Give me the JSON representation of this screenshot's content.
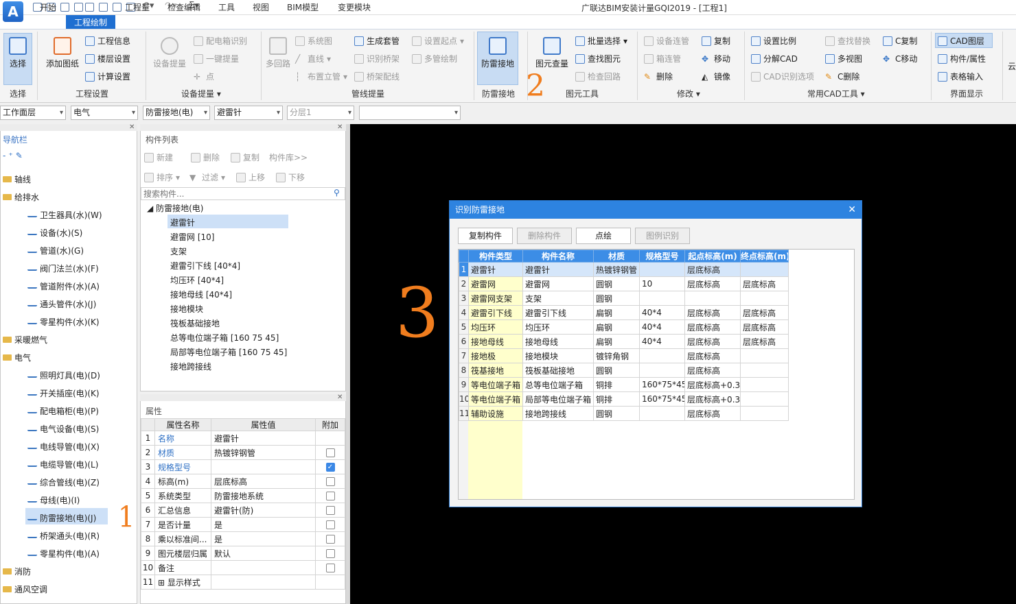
{
  "app": {
    "title": "广联达BIM安装计量GQI2019 - [工程1]",
    "logo": "A"
  },
  "menu": [
    "开始",
    "工程绘制",
    "工程量",
    "检查编辑",
    "工具",
    "视图",
    "BIM模型",
    "变更模块"
  ],
  "menu_active": "工程绘制",
  "ribbon": {
    "select": {
      "label": "选择",
      "group": "选择"
    },
    "project": {
      "add_drawing": "添加图纸",
      "info": "工程信息",
      "floors": "楼层设置",
      "calc": "计算设置",
      "group": "工程设置"
    },
    "equipment": {
      "big": "设备提量",
      "box_identify": "配电箱识别",
      "one_key": "一键提量",
      "point": "点",
      "group": "设备提量"
    },
    "pipeline": {
      "multi_loop": "多回路",
      "system_map": "系统图",
      "line": "直线",
      "riser": "布置立管",
      "gen_fitting": "生成套管",
      "identify_tray": "识别桥架",
      "tray_wire": "桥架配线",
      "set_start": "设置起点",
      "multi_draw": "多管绘制",
      "group": "管线提量"
    },
    "lightning": {
      "label": "防雷接地",
      "group": "防雷接地"
    },
    "elem_tools": {
      "query": "图元查量",
      "batch_select": "批量选择",
      "find": "查找图元",
      "check_loop": "检查回路",
      "group": "图元工具"
    },
    "modify": {
      "equip_link": "设备连管",
      "box_pipe": "箱连管",
      "delete": "删除",
      "copy": "复制",
      "move": "移动",
      "mirror": "镜像",
      "group": "修改"
    },
    "cad_tools": {
      "set_scale": "设置比例",
      "explode": "分解CAD",
      "cad_options": "CAD识别选项",
      "find_replace": "查找替换",
      "multi_view": "多视图",
      "c_delete": "C删除",
      "c_copy": "C复制",
      "c_move": "C移动",
      "group": "常用CAD工具"
    },
    "display": {
      "cad_layer": "CAD图层",
      "comp_attr": "构件/属性",
      "table_input": "表格输入",
      "group": "界面显示"
    },
    "cloud": "云"
  },
  "filters": [
    "工作面层",
    "电气",
    "防雷接地(电)",
    "避雷针",
    "分层1",
    ""
  ],
  "nav": {
    "title": "导航栏",
    "items": [
      {
        "label": "轴线",
        "level": 0
      },
      {
        "label": "给排水",
        "level": 0
      },
      {
        "label": "卫生器具(水)(W)",
        "level": 1
      },
      {
        "label": "设备(水)(S)",
        "level": 1
      },
      {
        "label": "管道(水)(G)",
        "level": 1
      },
      {
        "label": "阀门法兰(水)(F)",
        "level": 1
      },
      {
        "label": "管道附件(水)(A)",
        "level": 1
      },
      {
        "label": "通头管件(水)(J)",
        "level": 1
      },
      {
        "label": "零星构件(水)(K)",
        "level": 1
      },
      {
        "label": "采暖燃气",
        "level": 0
      },
      {
        "label": "电气",
        "level": 0
      },
      {
        "label": "照明灯具(电)(D)",
        "level": 1
      },
      {
        "label": "开关插座(电)(K)",
        "level": 1
      },
      {
        "label": "配电箱柜(电)(P)",
        "level": 1
      },
      {
        "label": "电气设备(电)(S)",
        "level": 1
      },
      {
        "label": "电线导管(电)(X)",
        "level": 1
      },
      {
        "label": "电缆导管(电)(L)",
        "level": 1
      },
      {
        "label": "综合管线(电)(Z)",
        "level": 1
      },
      {
        "label": "母线(电)(I)",
        "level": 1
      },
      {
        "label": "防雷接地(电)(J)",
        "level": 1
      },
      {
        "label": "桥架通头(电)(R)",
        "level": 1
      },
      {
        "label": "零星构件(电)(A)",
        "level": 1
      },
      {
        "label": "消防",
        "level": 0
      },
      {
        "label": "通风空调",
        "level": 0
      }
    ]
  },
  "complist": {
    "title": "构件列表",
    "tools": {
      "new": "新建",
      "delete": "删除",
      "copy": "复制",
      "library": "构件库>>",
      "sort": "排序",
      "filter": "过滤",
      "up": "上移",
      "down": "下移"
    },
    "search_placeholder": "搜索构件...",
    "root": "防雷接地(电)",
    "items": [
      "避雷针",
      "避雷网 [10]",
      "支架",
      "避雷引下线 [40*4]",
      "均压环 [40*4]",
      "接地母线 [40*4]",
      "接地模块",
      "筏板基础接地",
      "总等电位端子箱 [160 75 45]",
      "局部等电位端子箱 [160 75 45]",
      "接地跨接线"
    ]
  },
  "props": {
    "title": "属性",
    "headers": [
      "属性名称",
      "属性值",
      "附加"
    ],
    "rows": [
      {
        "n": "1",
        "name": "名称",
        "value": "避雷针",
        "cb": "none",
        "blue": true
      },
      {
        "n": "2",
        "name": "材质",
        "value": "热镀锌钢管",
        "cb": "off",
        "blue": true
      },
      {
        "n": "3",
        "name": "规格型号",
        "value": "",
        "cb": "on",
        "blue": true
      },
      {
        "n": "4",
        "name": "标高(m)",
        "value": "层底标高",
        "cb": "off",
        "blue": false
      },
      {
        "n": "5",
        "name": "系统类型",
        "value": "防雷接地系统",
        "cb": "off",
        "blue": false
      },
      {
        "n": "6",
        "name": "汇总信息",
        "value": "避雷针(防)",
        "cb": "off",
        "blue": false
      },
      {
        "n": "7",
        "name": "是否计量",
        "value": "是",
        "cb": "off",
        "blue": false
      },
      {
        "n": "8",
        "name": "乘以标准间...",
        "value": "是",
        "cb": "off",
        "blue": false
      },
      {
        "n": "9",
        "name": "图元楼层归属",
        "value": "默认",
        "cb": "off",
        "blue": false
      },
      {
        "n": "10",
        "name": "备注",
        "value": "",
        "cb": "off",
        "blue": false
      },
      {
        "n": "11",
        "name": "显示样式",
        "value": "",
        "cb": "none",
        "blue": false
      }
    ]
  },
  "dialog": {
    "title": "识别防雷接地",
    "buttons": [
      "复制构件",
      "删除构件",
      "点绘",
      "图例识别"
    ],
    "headers": [
      "构件类型",
      "构件名称",
      "材质",
      "规格型号",
      "起点标高(m)",
      "终点标高(m)"
    ],
    "rows": [
      [
        "1",
        "避雷针",
        "避雷针",
        "热镀锌钢管",
        "",
        "层底标高",
        ""
      ],
      [
        "2",
        "避雷网",
        "避雷网",
        "圆钢",
        "10",
        "层底标高",
        "层底标高"
      ],
      [
        "3",
        "避雷网支架",
        "支架",
        "圆钢",
        "",
        "",
        ""
      ],
      [
        "4",
        "避雷引下线",
        "避雷引下线",
        "扁钢",
        "40*4",
        "层底标高",
        "层底标高"
      ],
      [
        "5",
        "均压环",
        "均压环",
        "扁钢",
        "40*4",
        "层底标高",
        "层底标高"
      ],
      [
        "6",
        "接地母线",
        "接地母线",
        "扁钢",
        "40*4",
        "层底标高",
        "层底标高"
      ],
      [
        "7",
        "接地极",
        "接地模块",
        "镀锌角钢",
        "",
        "层底标高",
        ""
      ],
      [
        "8",
        "筏基接地",
        "筏板基础接地",
        "圆钢",
        "",
        "层底标高",
        ""
      ],
      [
        "9",
        "等电位端子箱",
        "总等电位端子箱",
        "铜排",
        "160*75*45",
        "层底标高+0.3",
        ""
      ],
      [
        "10",
        "等电位端子箱",
        "局部等电位端子箱",
        "铜排",
        "160*75*45",
        "层底标高+0.3",
        ""
      ],
      [
        "11",
        "辅助设施",
        "接地跨接线",
        "圆钢",
        "",
        "层底标高",
        ""
      ]
    ]
  },
  "annotations": [
    "1",
    "2",
    "3"
  ]
}
